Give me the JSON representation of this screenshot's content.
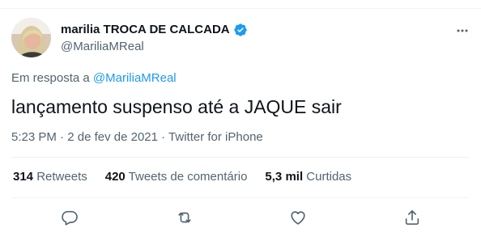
{
  "author": {
    "display_name": "marilia TROCA DE CALCADA",
    "handle": "@MariliaMReal",
    "verified": true
  },
  "reply": {
    "prefix": "Em resposta a",
    "handle": "@MariliaMReal"
  },
  "tweet": {
    "text": "lançamento suspenso até a JAQUE sair"
  },
  "meta": {
    "time": "5:23 PM",
    "date": "2 de fev de 2021",
    "source": "Twitter for iPhone"
  },
  "stats": {
    "retweets_count": "314",
    "retweets_label": "Retweets",
    "quotes_count": "420",
    "quotes_label": "Tweets de comentário",
    "likes_count": "5,3 mil",
    "likes_label": "Curtidas"
  },
  "colors": {
    "accent": "#1d9bf0",
    "secondary_text": "#536471",
    "primary_text": "#0f1419",
    "divider": "#eff3f4"
  },
  "icons": {
    "reply": "reply-icon",
    "retweet": "retweet-icon",
    "like": "heart-icon",
    "share": "share-icon",
    "more": "more-icon",
    "verified": "verified-badge-icon"
  }
}
